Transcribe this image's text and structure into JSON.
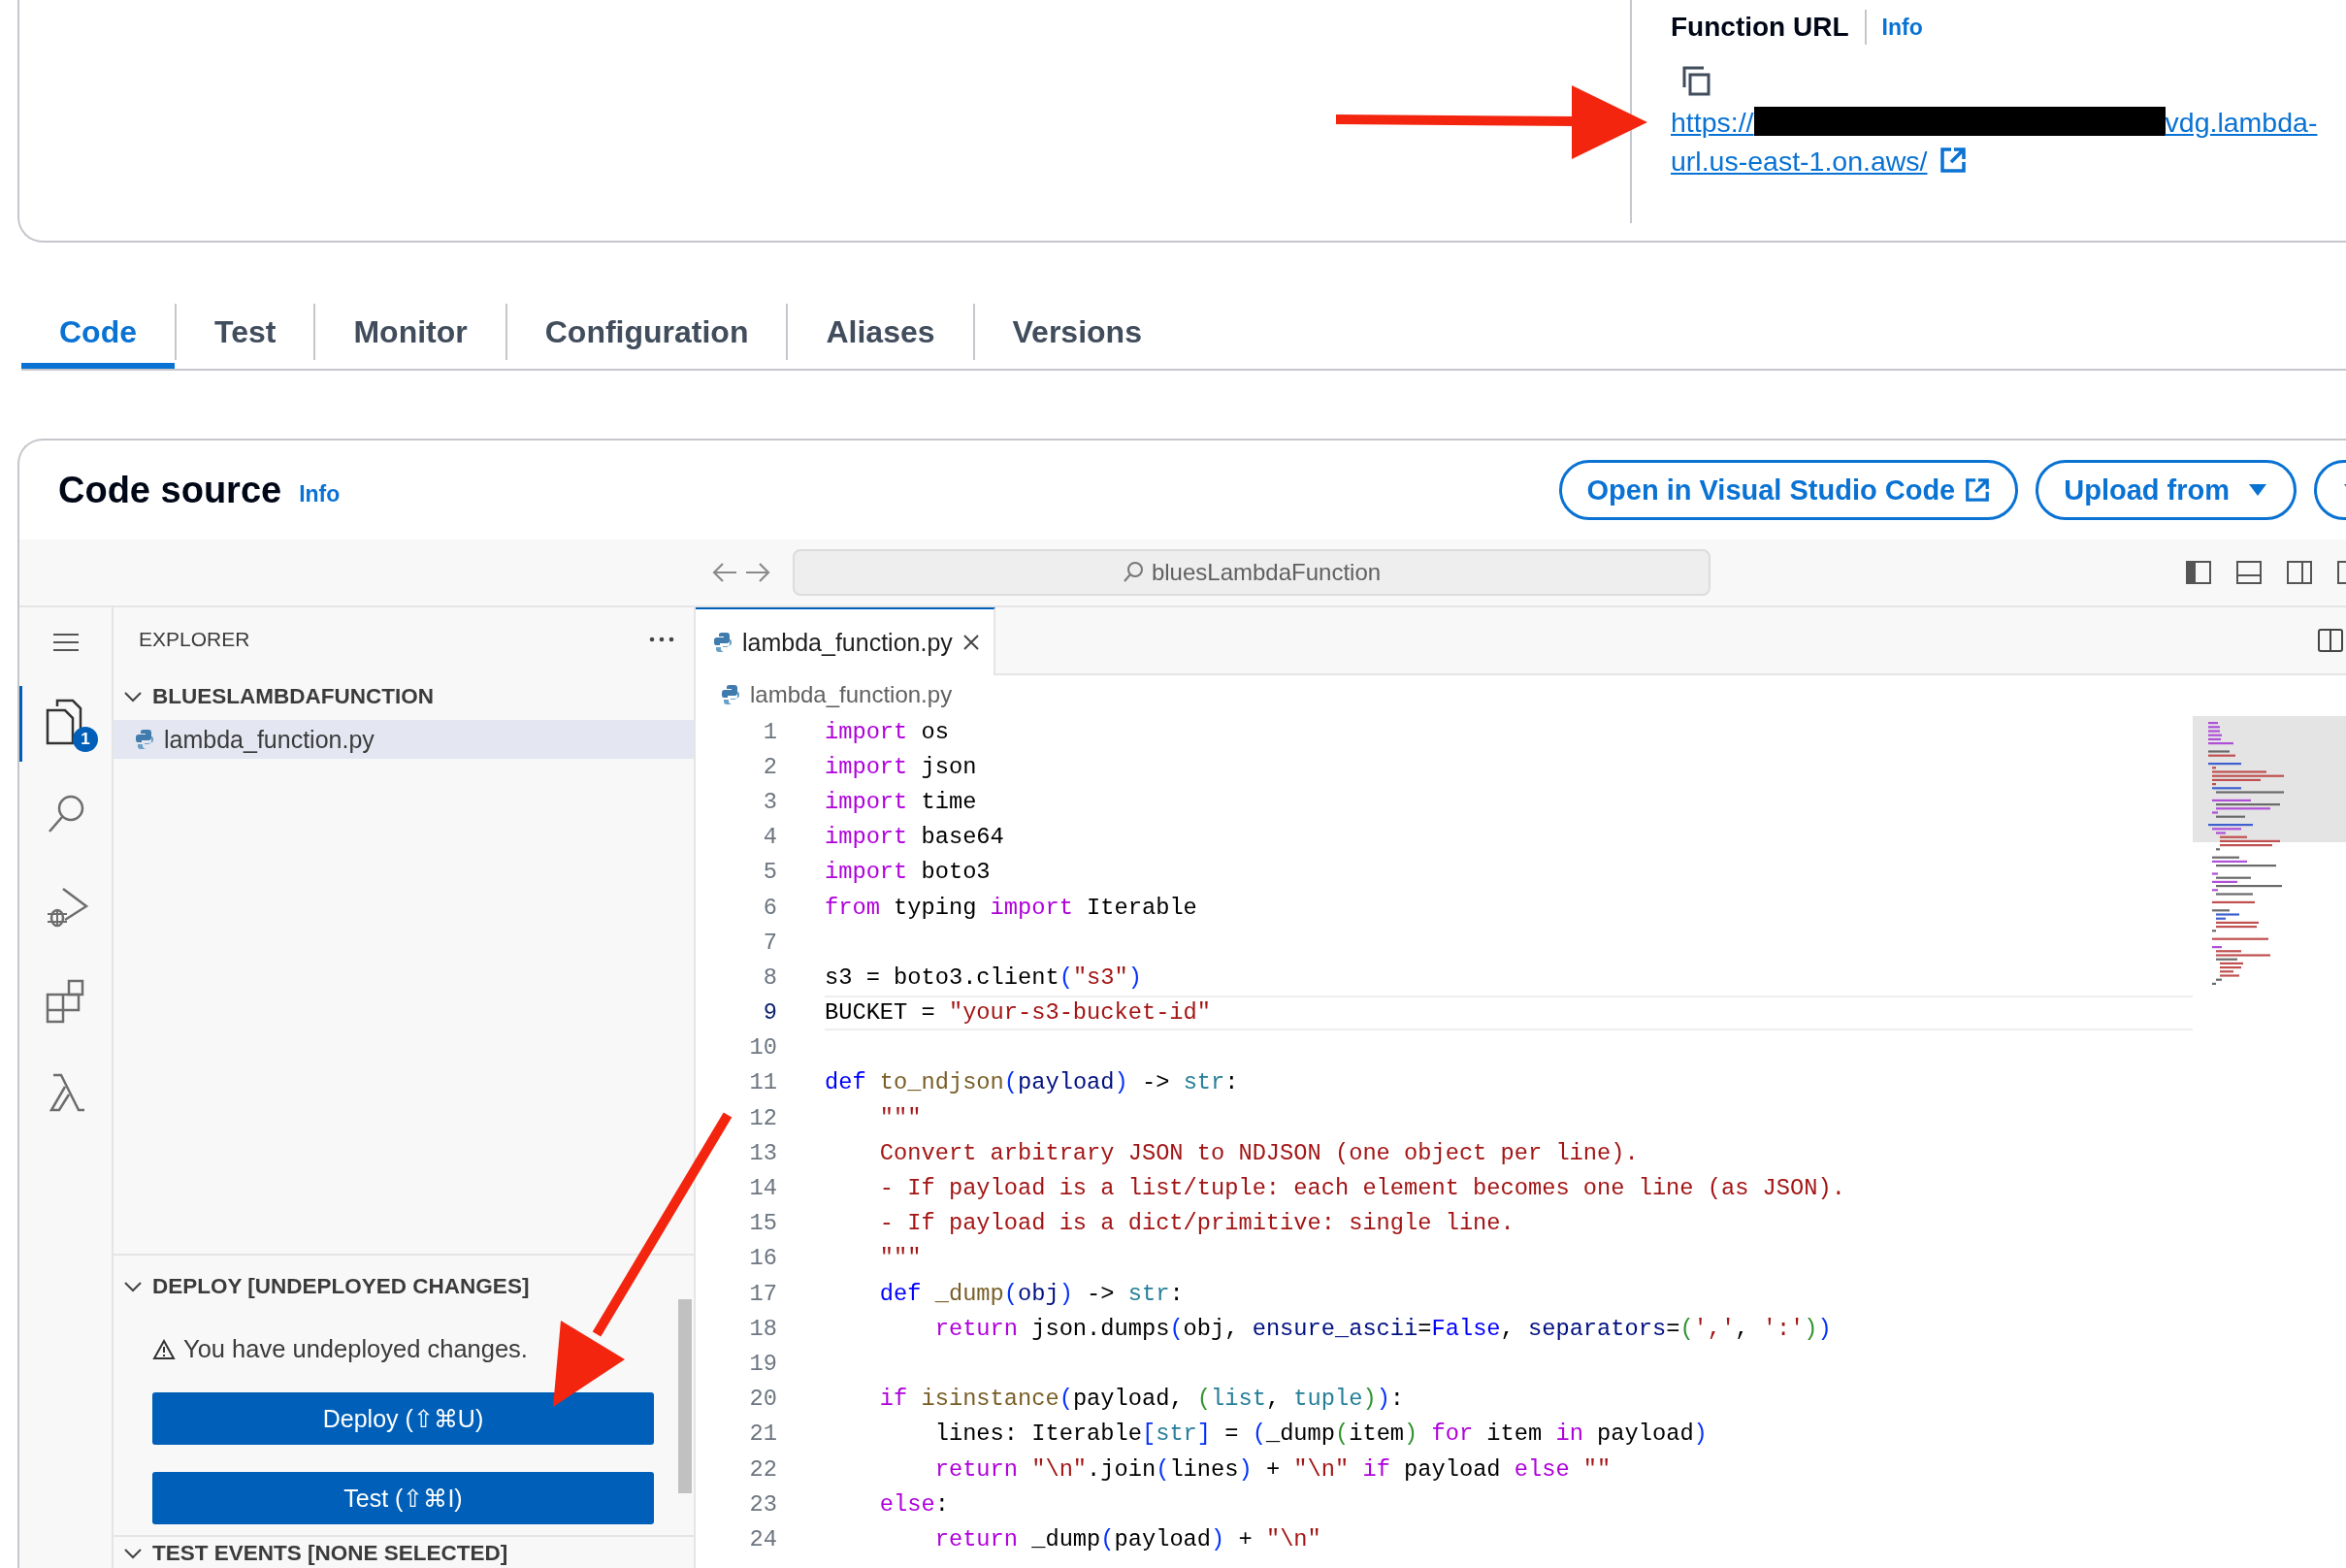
{
  "function_url": {
    "label": "Function URL",
    "info": "Info",
    "url_start": "https://",
    "redacted": true,
    "url_end": "vdg.lambda-",
    "url_line2": "url.us-east-1.on.aws/"
  },
  "tabs": [
    {
      "label": "Code",
      "selected": true
    },
    {
      "label": "Test",
      "selected": false
    },
    {
      "label": "Monitor",
      "selected": false
    },
    {
      "label": "Configuration",
      "selected": false
    },
    {
      "label": "Aliases",
      "selected": false
    },
    {
      "label": "Versions",
      "selected": false
    }
  ],
  "code_source": {
    "title": "Code source",
    "info": "Info",
    "buttons": [
      {
        "label": "Open in Visual Studio Code",
        "kind": "external"
      },
      {
        "label": "Upload from",
        "kind": "dropdown"
      }
    ]
  },
  "ide": {
    "command_center": "bluesLambdaFunction",
    "activity_bar": [
      {
        "kind": "explorer",
        "selected": true,
        "badge": "1"
      },
      {
        "kind": "search",
        "selected": false
      },
      {
        "kind": "run",
        "selected": false
      },
      {
        "kind": "extensions",
        "selected": false
      },
      {
        "kind": "lambda",
        "selected": false
      }
    ],
    "explorer": {
      "title": "EXPLORER",
      "folder": {
        "name": "BLUESLAMBDAFUNCTION",
        "expanded": true,
        "files": [
          {
            "name": "lambda_function.py",
            "selected": true
          }
        ]
      }
    },
    "deploy": {
      "title": "DEPLOY [UNDEPLOYED CHANGES]",
      "expanded": true,
      "warning": "You have undeployed changes.",
      "buttons": [
        "Deploy (⇧⌘U)",
        "Test (⇧⌘I)"
      ]
    },
    "test_events": {
      "title": "TEST EVENTS [NONE SELECTED]",
      "expanded": true
    },
    "editor": {
      "tabs": [
        {
          "name": "lambda_function.py",
          "selected": true
        }
      ],
      "breadcrumb": "lambda_function.py",
      "lines": [
        {
          "n": "1",
          "current": false,
          "tokens": [
            {
              "text": "import",
              "kind": "kw"
            },
            {
              "text": " os",
              "kind": "p"
            }
          ]
        },
        {
          "n": "2",
          "current": false,
          "tokens": [
            {
              "text": "import",
              "kind": "kw"
            },
            {
              "text": " json",
              "kind": "p"
            }
          ]
        },
        {
          "n": "3",
          "current": false,
          "tokens": [
            {
              "text": "import",
              "kind": "kw"
            },
            {
              "text": " time",
              "kind": "p"
            }
          ]
        },
        {
          "n": "4",
          "current": false,
          "tokens": [
            {
              "text": "import",
              "kind": "kw"
            },
            {
              "text": " base64",
              "kind": "p"
            }
          ]
        },
        {
          "n": "5",
          "current": false,
          "tokens": [
            {
              "text": "import",
              "kind": "kw"
            },
            {
              "text": " boto3",
              "kind": "p"
            }
          ]
        },
        {
          "n": "6",
          "current": false,
          "tokens": [
            {
              "text": "from",
              "kind": "kw"
            },
            {
              "text": " typing ",
              "kind": "p"
            },
            {
              "text": "import",
              "kind": "kw"
            },
            {
              "text": " Iterable",
              "kind": "p"
            }
          ]
        },
        {
          "n": "7",
          "current": false
        },
        {
          "n": "8",
          "current": false,
          "tokens": [
            {
              "text": "s3 = boto3.client",
              "kind": "p"
            },
            {
              "text": "(",
              "kind": "b1"
            },
            {
              "text": "\"s3\"",
              "kind": "str"
            },
            {
              "text": ")",
              "kind": "b1"
            }
          ]
        },
        {
          "n": "9",
          "current": true,
          "tokens": [
            {
              "text": "BUCKET = ",
              "kind": "p"
            },
            {
              "text": "\"your-s3-bucket-id\"",
              "kind": "str"
            }
          ]
        },
        {
          "n": "10",
          "current": false
        },
        {
          "n": "11",
          "current": false,
          "tokens": [
            {
              "text": "def",
              "kind": "def"
            },
            {
              "text": " to_ndjson",
              "kind": "fn"
            },
            {
              "text": "(",
              "kind": "b1"
            },
            {
              "text": "payload",
              "kind": "var"
            },
            {
              "text": ")",
              "kind": "b1"
            },
            {
              "text": " -> ",
              "kind": "p"
            },
            {
              "text": "str",
              "kind": "type"
            },
            {
              "text": ":",
              "kind": "p"
            }
          ]
        },
        {
          "n": "12",
          "current": false,
          "tokens": [
            {
              "text": "    \"\"\"",
              "kind": "str"
            }
          ]
        },
        {
          "n": "13",
          "current": false,
          "tokens": [
            {
              "text": "    Convert arbitrary JSON to NDJSON (one object per line).",
              "kind": "str"
            }
          ]
        },
        {
          "n": "14",
          "current": false,
          "tokens": [
            {
              "text": "    - If payload is a list/tuple: each element becomes one line (as JSON).",
              "kind": "str"
            }
          ]
        },
        {
          "n": "15",
          "current": false,
          "tokens": [
            {
              "text": "    - If payload is a dict/primitive: single line.",
              "kind": "str"
            }
          ]
        },
        {
          "n": "16",
          "current": false,
          "tokens": [
            {
              "text": "    \"\"\"",
              "kind": "str"
            }
          ]
        },
        {
          "n": "17",
          "current": false,
          "tokens": [
            {
              "text": "    def",
              "kind": "def"
            },
            {
              "text": " _dump",
              "kind": "fn"
            },
            {
              "text": "(",
              "kind": "b1"
            },
            {
              "text": "obj",
              "kind": "var"
            },
            {
              "text": ")",
              "kind": "b1"
            },
            {
              "text": " -> ",
              "kind": "p"
            },
            {
              "text": "str",
              "kind": "type"
            },
            {
              "text": ":",
              "kind": "p"
            }
          ]
        },
        {
          "n": "18",
          "current": false,
          "tokens": [
            {
              "text": "        return",
              "kind": "kw"
            },
            {
              "text": " json.dumps",
              "kind": "p"
            },
            {
              "text": "(",
              "kind": "b1"
            },
            {
              "text": "obj, ",
              "kind": "p"
            },
            {
              "text": "ensure_ascii",
              "kind": "var"
            },
            {
              "text": "=",
              "kind": "p"
            },
            {
              "text": "False",
              "kind": "def"
            },
            {
              "text": ", ",
              "kind": "p"
            },
            {
              "text": "separators",
              "kind": "var"
            },
            {
              "text": "=",
              "kind": "p"
            },
            {
              "text": "(",
              "kind": "b2"
            },
            {
              "text": "','",
              "kind": "str"
            },
            {
              "text": ", ",
              "kind": "p"
            },
            {
              "text": "':'",
              "kind": "str"
            },
            {
              "text": ")",
              "kind": "b2"
            },
            {
              "text": ")",
              "kind": "b1"
            }
          ]
        },
        {
          "n": "19",
          "current": false
        },
        {
          "n": "20",
          "current": false,
          "tokens": [
            {
              "text": "    if",
              "kind": "kw"
            },
            {
              "text": " isinstance",
              "kind": "fn"
            },
            {
              "text": "(",
              "kind": "b1"
            },
            {
              "text": "payload, ",
              "kind": "p"
            },
            {
              "text": "(",
              "kind": "b2"
            },
            {
              "text": "list",
              "kind": "type"
            },
            {
              "text": ", ",
              "kind": "p"
            },
            {
              "text": "tuple",
              "kind": "type"
            },
            {
              "text": ")",
              "kind": "b2"
            },
            {
              "text": ")",
              "kind": "b1"
            },
            {
              "text": ":",
              "kind": "p"
            }
          ]
        },
        {
          "n": "21",
          "current": false,
          "tokens": [
            {
              "text": "        lines: Iterable",
              "kind": "p"
            },
            {
              "text": "[",
              "kind": "b1"
            },
            {
              "text": "str",
              "kind": "type"
            },
            {
              "text": "]",
              "kind": "b1"
            },
            {
              "text": " = ",
              "kind": "p"
            },
            {
              "text": "(",
              "kind": "b1"
            },
            {
              "text": "_dump",
              "kind": "p"
            },
            {
              "text": "(",
              "kind": "b2"
            },
            {
              "text": "item",
              "kind": "p"
            },
            {
              "text": ")",
              "kind": "b2"
            },
            {
              "text": " for",
              "kind": "kw"
            },
            {
              "text": " item ",
              "kind": "p"
            },
            {
              "text": "in",
              "kind": "kw"
            },
            {
              "text": " payload",
              "kind": "p"
            },
            {
              "text": ")",
              "kind": "b1"
            }
          ]
        },
        {
          "n": "22",
          "current": false,
          "tokens": [
            {
              "text": "        return",
              "kind": "kw"
            },
            {
              "text": " \"\\n\"",
              "kind": "str"
            },
            {
              "text": ".join",
              "kind": "p"
            },
            {
              "text": "(",
              "kind": "b1"
            },
            {
              "text": "lines",
              "kind": "p"
            },
            {
              "text": ")",
              "kind": "b1"
            },
            {
              "text": " + ",
              "kind": "p"
            },
            {
              "text": "\"\\n\"",
              "kind": "str"
            },
            {
              "text": " if",
              "kind": "kw"
            },
            {
              "text": " payload ",
              "kind": "p"
            },
            {
              "text": "else",
              "kind": "kw"
            },
            {
              "text": " \"\"",
              "kind": "str"
            }
          ]
        },
        {
          "n": "23",
          "current": false,
          "tokens": [
            {
              "text": "    else",
              "kind": "kw"
            },
            {
              "text": ":",
              "kind": "p"
            }
          ]
        },
        {
          "n": "24",
          "current": false,
          "tokens": [
            {
              "text": "        return",
              "kind": "kw"
            },
            {
              "text": " _dump",
              "kind": "p"
            },
            {
              "text": "(",
              "kind": "b1"
            },
            {
              "text": "payload",
              "kind": "p"
            },
            {
              "text": ")",
              "kind": "b1"
            },
            {
              "text": " + ",
              "kind": "p"
            },
            {
              "text": "\"\\n\"",
              "kind": "str"
            }
          ]
        }
      ]
    }
  }
}
